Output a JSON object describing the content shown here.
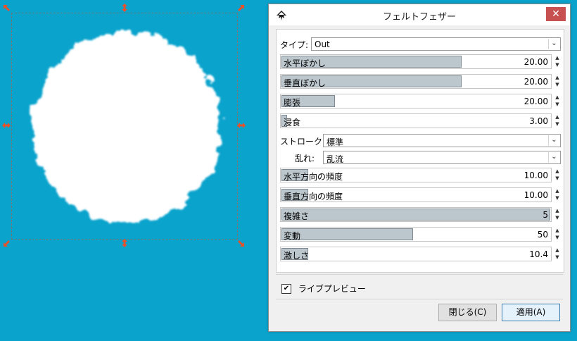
{
  "dialog": {
    "title": "フェルトフェザー",
    "close_glyph": "✕"
  },
  "type_row": {
    "label": "タイプ:",
    "value": "Out"
  },
  "sliders": [
    {
      "label": "水平ぼかし",
      "value": "20.00",
      "fill_fraction": 0.67
    },
    {
      "label": "垂直ぼかし",
      "value": "20.00",
      "fill_fraction": 0.67
    },
    {
      "label": "膨張",
      "value": "20.00",
      "fill_fraction": 0.2
    },
    {
      "label": "浸食",
      "value": "3.00",
      "fill_fraction": 0.02
    }
  ],
  "stroke_row": {
    "label": "ストローク:",
    "value": "標準"
  },
  "turbulence_row": {
    "label": "乱れ:",
    "value": "乱流"
  },
  "sliders2": [
    {
      "label": "水平方向の頻度",
      "value": "10.00",
      "fill_fraction": 0.1
    },
    {
      "label": "垂直方向の頻度",
      "value": "10.00",
      "fill_fraction": 0.1
    },
    {
      "label": "複雑さ",
      "value": "5",
      "fill_fraction": 1.0
    },
    {
      "label": "変動",
      "value": "50",
      "fill_fraction": 0.49
    },
    {
      "label": "激しさ",
      "value": "10.4",
      "fill_fraction": 0.1
    }
  ],
  "live_preview": {
    "label": "ライブプレビュー",
    "checked": true,
    "check_glyph": "✔"
  },
  "buttons": {
    "close": "閉じる(C)",
    "apply": "適用(A)"
  },
  "icons": [
    "inkscape-app-icon",
    "chevron-down-icon",
    "spin-up-icon",
    "spin-down-icon",
    "resize-arrow-icon"
  ],
  "colors": {
    "canvas_bg": "#0aa3cc",
    "handle": "#e8502a",
    "slider_fill": "#bcc6cd"
  }
}
